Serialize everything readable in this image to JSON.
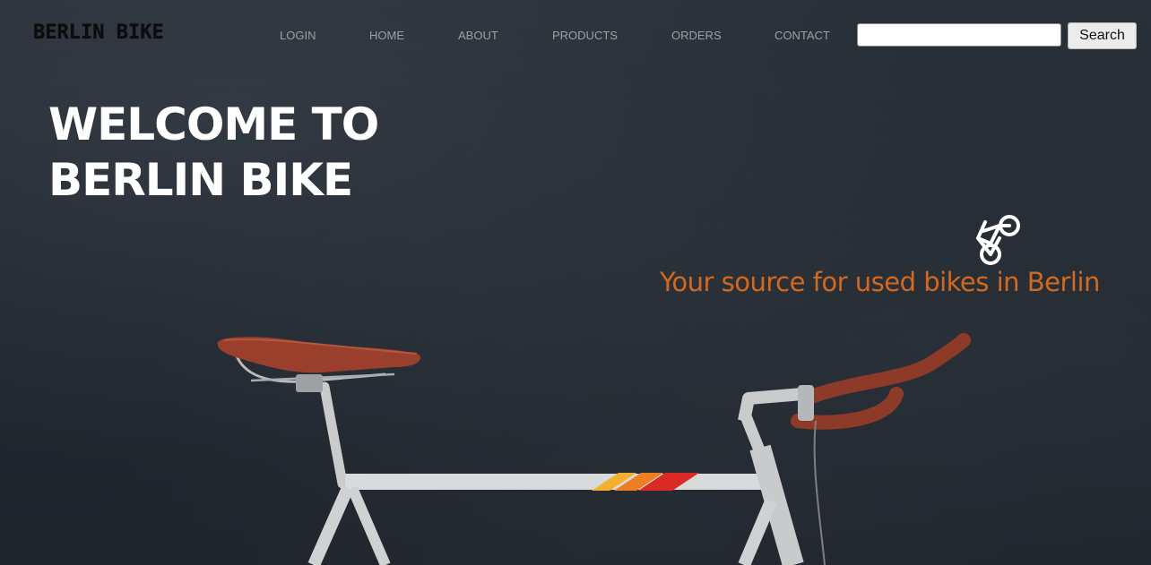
{
  "header": {
    "logo_text": "BERLIN BIKE"
  },
  "nav": {
    "items": [
      {
        "label": "LOGIN"
      },
      {
        "label": "HOME"
      },
      {
        "label": "ABOUT"
      },
      {
        "label": "PRODUCTS"
      },
      {
        "label": "ORDERS"
      },
      {
        "label": "CONTACT"
      }
    ]
  },
  "search": {
    "value": "",
    "placeholder": "",
    "button_label": "Search"
  },
  "hero": {
    "title_line1": "WELCOME TO",
    "title_line2": "BERLIN BIKE",
    "icon": "bicycle-icon",
    "tagline": "Your source for used bikes in Berlin"
  },
  "colors": {
    "background": "#23282f",
    "tagline": "#d2691e",
    "title": "#ffffff",
    "nav_text": "#9aa0a6"
  }
}
